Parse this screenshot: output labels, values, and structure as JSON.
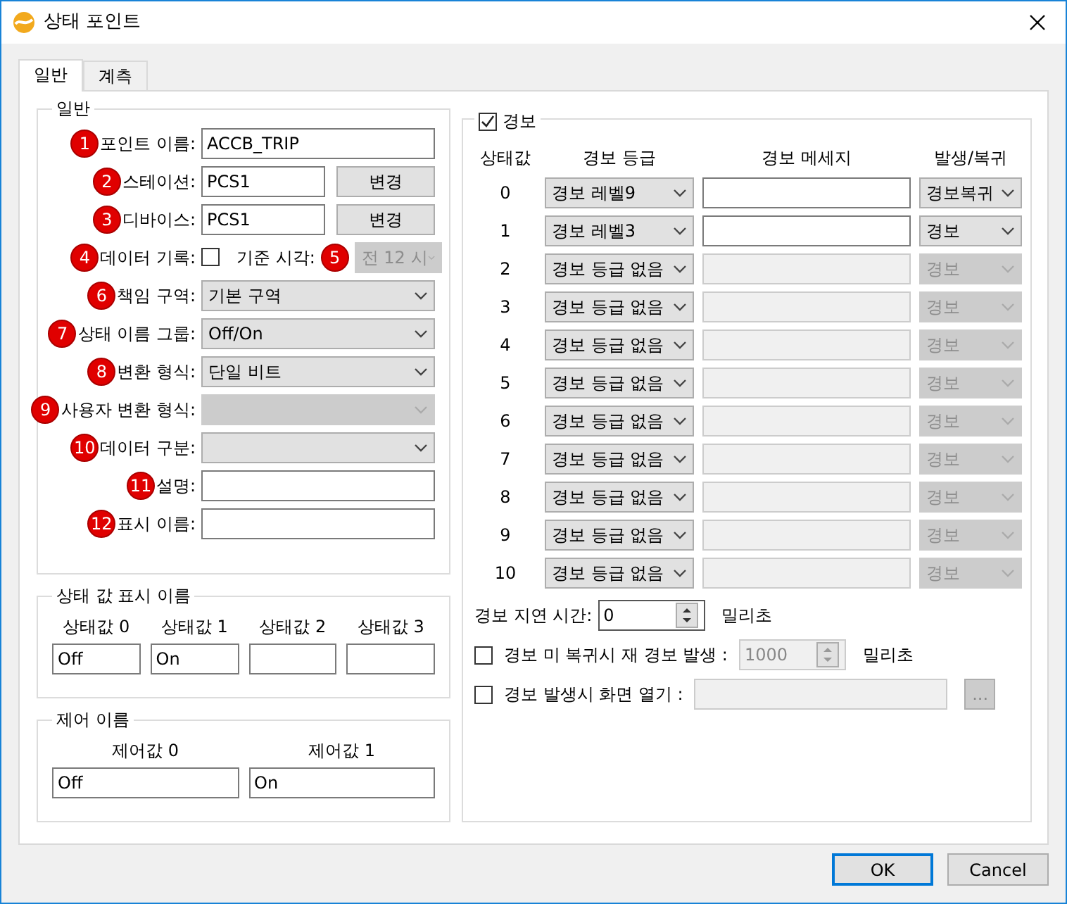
{
  "window": {
    "title": "상태 포인트"
  },
  "tabs": [
    {
      "label": "일반",
      "selected": true
    },
    {
      "label": "계측",
      "selected": false
    }
  ],
  "general": {
    "title": "일반",
    "fields": [
      {
        "kind": "text",
        "badge": "1",
        "label": "포인트 이름:",
        "value": "ACCB_TRIP"
      },
      {
        "kind": "text_button",
        "badge": "2",
        "label": "스테이션:",
        "value": "PCS1",
        "button": "변경"
      },
      {
        "kind": "text_button",
        "badge": "3",
        "label": "디바이스:",
        "value": "PCS1",
        "button": "변경"
      },
      {
        "kind": "checkbox_time",
        "badge": "4",
        "label": "데이터 기록:",
        "checked": false,
        "label2": "기준 시각:",
        "badge2": "5",
        "value": "전 12 시",
        "disabled": true
      },
      {
        "kind": "select",
        "badge": "6",
        "label": "책임 구역:",
        "value": "기본 구역",
        "disabled": false
      },
      {
        "kind": "select",
        "badge": "7",
        "label": "상태 이름 그룹:",
        "value": "Off/On",
        "disabled": false
      },
      {
        "kind": "select",
        "badge": "8",
        "label": "변환 형식:",
        "value": "단일 비트",
        "disabled": false
      },
      {
        "kind": "select",
        "badge": "9",
        "label": "사용자 변환 형식:",
        "disabled": true
      },
      {
        "kind": "select",
        "badge": "10",
        "label": "데이터 구분:",
        "disabled": false
      },
      {
        "kind": "text",
        "badge": "11",
        "label": "설명:"
      },
      {
        "kind": "text",
        "badge": "12",
        "label": "표시 이름:"
      }
    ]
  },
  "state_names": {
    "title": "상태 값 표시 이름",
    "items": [
      {
        "label": "상태값 0",
        "value": "Off"
      },
      {
        "label": "상태값 1",
        "value": "On"
      },
      {
        "label": "상태값 2"
      },
      {
        "label": "상태값 3"
      }
    ]
  },
  "control_names": {
    "title": "제어 이름",
    "items": [
      {
        "label": "제어값 0",
        "value": "Off"
      },
      {
        "label": "제어값 1",
        "value": "On"
      }
    ]
  },
  "alarm": {
    "title": "경보",
    "checked": true,
    "columns": [
      "상태값",
      "경보 등급",
      "경보 메세지",
      "발생/복귀"
    ],
    "rows": [
      {
        "state": "0",
        "grade": "경보 레벨9",
        "type": "경보복귀",
        "enabled": true
      },
      {
        "state": "1",
        "grade": "경보 레벨3",
        "type": "경보",
        "enabled": true
      },
      {
        "state": "2",
        "grade": "경보 등급 없음",
        "type": "경보",
        "enabled": false
      },
      {
        "state": "3",
        "grade": "경보 등급 없음",
        "type": "경보",
        "enabled": false
      },
      {
        "state": "4",
        "grade": "경보 등급 없음",
        "type": "경보",
        "enabled": false
      },
      {
        "state": "5",
        "grade": "경보 등급 없음",
        "type": "경보",
        "enabled": false
      },
      {
        "state": "6",
        "grade": "경보 등급 없음",
        "type": "경보",
        "enabled": false
      },
      {
        "state": "7",
        "grade": "경보 등급 없음",
        "type": "경보",
        "enabled": false
      },
      {
        "state": "8",
        "grade": "경보 등급 없음",
        "type": "경보",
        "enabled": false
      },
      {
        "state": "9",
        "grade": "경보 등급 없음",
        "type": "경보",
        "enabled": false
      },
      {
        "state": "10",
        "grade": "경보 등급 없음",
        "type": "경보",
        "enabled": false
      }
    ],
    "delay": {
      "label": "경보 지연 시간:",
      "value": "0",
      "unit": "밀리초"
    },
    "realarm": {
      "label": "경보 미 복귀시 재 경보 발생 :",
      "checked": false,
      "value": "1000",
      "unit": "밀리초",
      "disabled": true
    },
    "open_screen": {
      "label": "경보 발생시 화면 열기 :",
      "checked": false,
      "button": "...",
      "disabled": true
    }
  },
  "buttons": [
    {
      "label": "OK",
      "default": true
    },
    {
      "label": "Cancel",
      "default": false
    }
  ]
}
